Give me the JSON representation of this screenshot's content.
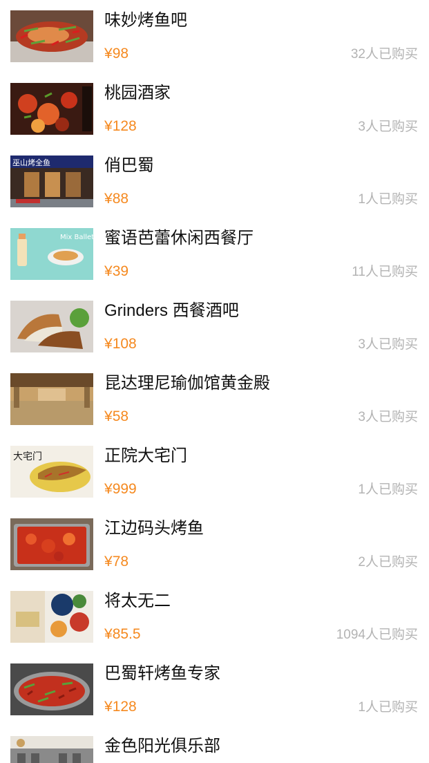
{
  "currency": "¥",
  "items": [
    {
      "name": "味妙烤鱼吧",
      "price": "98",
      "sold": "32人已购买",
      "image": "grilled-fish"
    },
    {
      "name": "桃园酒家",
      "price": "128",
      "sold": "3人已购买",
      "image": "spicy-dish"
    },
    {
      "name": "俏巴蜀",
      "price": "88",
      "sold": "1人已购买",
      "image": "storefront",
      "image_text": "巫山烤全鱼"
    },
    {
      "name": "蜜语芭蕾休闲西餐厅",
      "price": "39",
      "sold": "11人已购买",
      "image": "cafe-menu",
      "image_text": "Mix Ballet"
    },
    {
      "name": "Grinders 西餐酒吧",
      "price": "108",
      "sold": "3人已购买",
      "image": "sandwich"
    },
    {
      "name": "昆达理尼瑜伽馆黄金殿",
      "price": "58",
      "sold": "3人已购买",
      "image": "yoga-hall"
    },
    {
      "name": "正院大宅门",
      "price": "999",
      "sold": "1人已购买",
      "image": "fish-dish",
      "image_text": "大宅门"
    },
    {
      "name": "江边码头烤鱼",
      "price": "78",
      "sold": "2人已购买",
      "image": "crayfish-tray"
    },
    {
      "name": "将太无二",
      "price": "85.5",
      "sold": "1094人已购买",
      "image": "sushi-collage"
    },
    {
      "name": "巴蜀轩烤鱼专家",
      "price": "128",
      "sold": "1人已购买",
      "image": "chili-fish"
    },
    {
      "name": "金色阳光俱乐部",
      "price": "",
      "sold": "",
      "image": "building"
    }
  ]
}
